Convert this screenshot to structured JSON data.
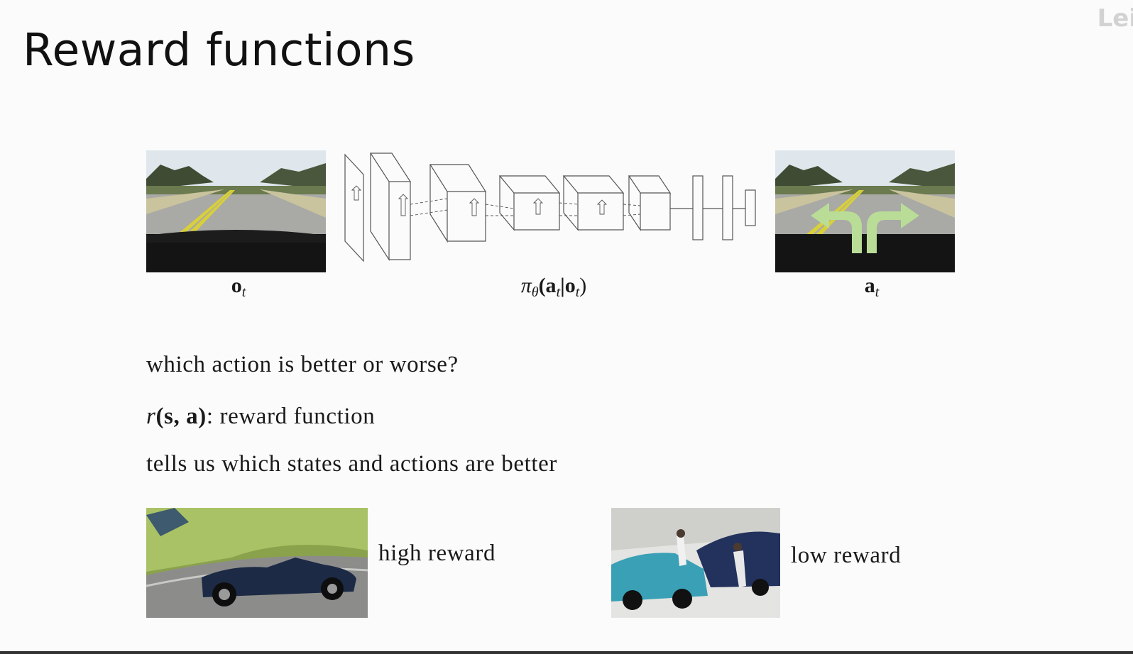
{
  "slide": {
    "title": "Reward functions",
    "corner_mark": "Lei",
    "observation_label": "o",
    "observation_sub": "t",
    "policy_label_prefix": "π",
    "policy_label_sub": "θ",
    "policy_label_args": "(a",
    "policy_label_args_sub": "t",
    "policy_label_mid": "|o",
    "policy_label_mid_sub": "t",
    "policy_label_end": ")",
    "action_label": "a",
    "action_sub": "t",
    "question": "which action is better or worse?",
    "reward_def_math": "r",
    "reward_def_args": "(s, a)",
    "reward_def_text": ": reward function",
    "reward_desc": "tells us which states and actions are better",
    "high_reward_label": "high reward",
    "low_reward_label": "low reward"
  },
  "colors": {
    "arrow": "#b9dd97",
    "sky": "#dfe7ec",
    "road": "#a9a9a6",
    "dashboard": "#141414"
  }
}
